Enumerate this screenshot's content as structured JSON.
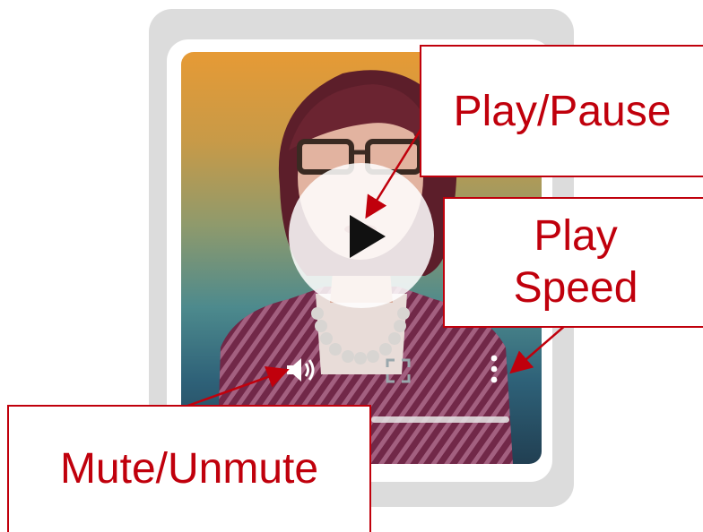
{
  "callouts": {
    "play_pause": "Play/Pause",
    "play_speed_line1": "Play",
    "play_speed_line2": "Speed",
    "mute_unmute": "Mute/Unmute"
  },
  "player": {
    "state": "paused",
    "controls": {
      "play_icon": "play-triangle-icon",
      "volume_icon": "speaker-icon",
      "fullscreen_icon": "fullscreen-corners-icon",
      "more_icon": "vertical-dots-icon"
    }
  },
  "colors": {
    "callout_red": "#c0000c",
    "frame_gray": "#dcdcdc"
  }
}
